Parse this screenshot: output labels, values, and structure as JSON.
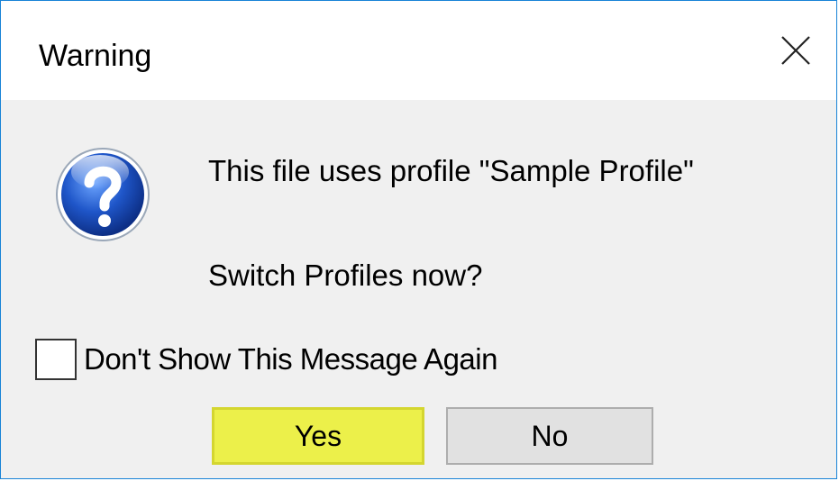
{
  "dialog": {
    "title": "Warning",
    "icon": "question-icon",
    "message_line1": "This file uses profile \"Sample Profile\"",
    "message_line2": "Switch Profiles now?",
    "checkbox": {
      "label": "Don't Show This Message Again",
      "checked": false
    },
    "buttons": {
      "yes_label": "Yes",
      "no_label": "No"
    }
  },
  "colors": {
    "window_border": "#1883d7",
    "highlight": "#ecf04a",
    "dialog_background": "#f0f0f0"
  }
}
